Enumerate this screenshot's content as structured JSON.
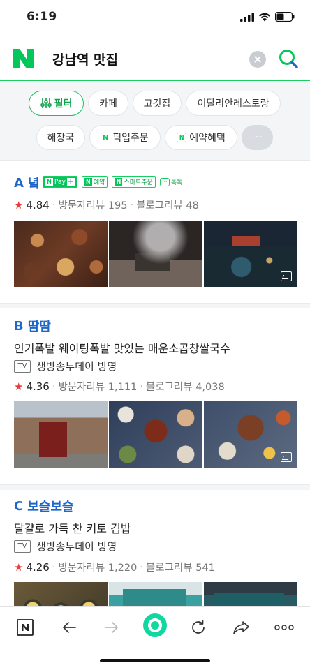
{
  "status_bar": {
    "time": "6:19"
  },
  "search": {
    "query": "강남역 맛집"
  },
  "chips": {
    "row1": [
      "필터",
      "카페",
      "고깃집",
      "이탈리안레스토랑"
    ],
    "row2": [
      "해장국",
      "픽업주문",
      "예약혜택"
    ],
    "more": "···"
  },
  "results": [
    {
      "letter": "A",
      "name": "녘",
      "tags": {
        "pay": "Pay",
        "reserve": "예약",
        "smart_order": "스마트주문",
        "talk": "톡톡"
      },
      "rating": "4.84",
      "visitor_reviews": "방문자리뷰 195",
      "blog_reviews": "블로그리뷰 48"
    },
    {
      "letter": "B",
      "name": "땀땀",
      "description": "인기폭발 웨이팅폭발 맛있는 매운소곱창쌀국수",
      "tv_badge": "TV",
      "tv_text": "생방송투데이 방영",
      "rating": "4.36",
      "visitor_reviews": "방문자리뷰 1,111",
      "blog_reviews": "블로그리뷰 4,038"
    },
    {
      "letter": "C",
      "name": "보슬보슬",
      "description": "달걀로 가득 찬 키토 김밥",
      "tv_badge": "TV",
      "tv_text": "생방송투데이 방영",
      "rating": "4.26",
      "visitor_reviews": "방문자리뷰 1,220",
      "blog_reviews": "블로그리뷰 541"
    }
  ],
  "colors": {
    "naver_green": "#03c75a",
    "link_blue": "#1e67c9",
    "star_red": "#ec3b3b"
  },
  "icons": [
    "naver-logo",
    "clear-icon",
    "search-icon",
    "filter-icon",
    "gallery-icon",
    "back-icon",
    "forward-icon",
    "reload-icon",
    "share-icon",
    "more-icon"
  ]
}
